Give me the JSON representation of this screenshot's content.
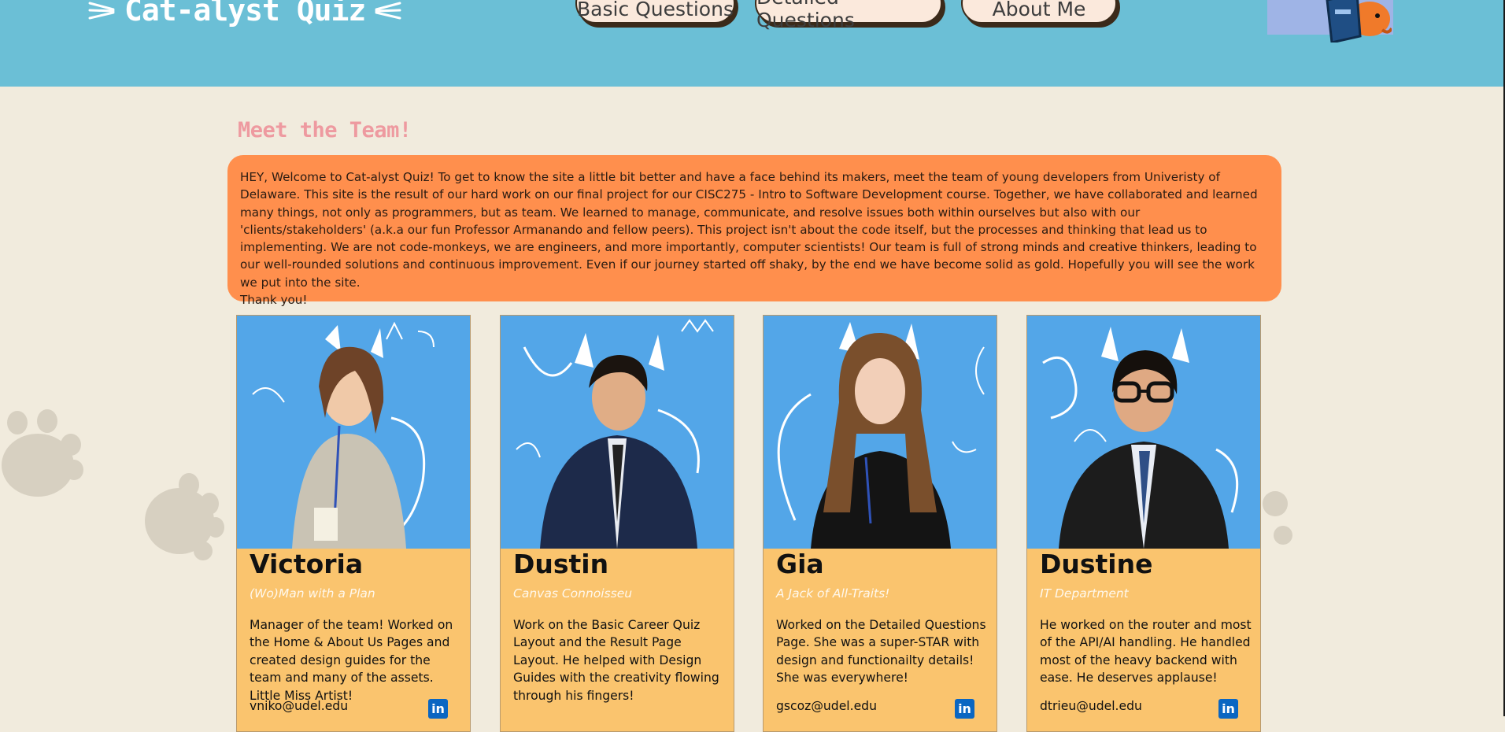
{
  "header": {
    "brand": "Cat-alyst Quiz",
    "nav": [
      {
        "label": "Basic Questions"
      },
      {
        "label": "Detailed Questions"
      },
      {
        "label": "About Me"
      }
    ]
  },
  "section": {
    "title": "Meet the Team!",
    "intro": "HEY, Welcome to Cat-alyst Quiz! To get to know the site a little bit better and have a face behind its makers, meet the team of young developers from Univeristy of Delaware. This site is the result of our hard work on our final project for our CISC275 - Intro to Software Development course. Together, we have collaborated and learned many things, not only as programmers, but as team. We learned to manage, communicate, and resolve issues both within ourselves but also with our 'clients/stakeholders' (a.k.a our fun Professor Armanando and fellow peers). This project isn't about the code itself, but the processes and thinking that lead us to implementing. We are not code-monkeys, we are engineers, and more importantly, computer scientists! Our team is full of strong minds and creative thinkers, leading to our well-rounded solutions and continuous improvement. Even if our journey started off shaky, by the end we have become solid as gold. Hopefully you will see the work we put into the site.",
    "closing": "Thank you!"
  },
  "team": [
    {
      "name": "Victoria",
      "role": "(Wo)Man with a Plan",
      "bio": "Manager of the team! Worked on the Home & About Us Pages and created design guides for the team and many of the assets. Little Miss Artist!",
      "email": "vniko@udel.edu",
      "linkedin": "in"
    },
    {
      "name": "Dustin",
      "role": "Canvas Connoisseu",
      "bio": "Work on the Basic Career Quiz Layout and the Result Page Layout. He helped with Design Guides with the creativity flowing through his fingers!",
      "email": "",
      "linkedin": ""
    },
    {
      "name": "Gia",
      "role": "A Jack of All-Traits!",
      "bio": "Worked on the Detailed Questions Page. She was a super-STAR with design and functionailty details! She was everywhere!",
      "email": "gscoz@udel.edu",
      "linkedin": "in"
    },
    {
      "name": "Dustine",
      "role": "IT Department",
      "bio": "He worked on the router and most of the API/AI handling. He handled most of the heavy backend with ease. He deserves applause!",
      "email": "dtrieu@udel.edu",
      "linkedin": "in"
    }
  ],
  "colors": {
    "header": "#6bbfd6",
    "page": "#f1ebdd",
    "intro": "#ff8f4d",
    "card": "#fac46e",
    "photo_bg": "#53a6e8",
    "title": "#ee9aa0",
    "linkedin": "#0a66c2"
  },
  "icons": {
    "logo": "whisker-icon",
    "linkedin": "linkedin-icon",
    "decor": "paw-print-icon"
  }
}
